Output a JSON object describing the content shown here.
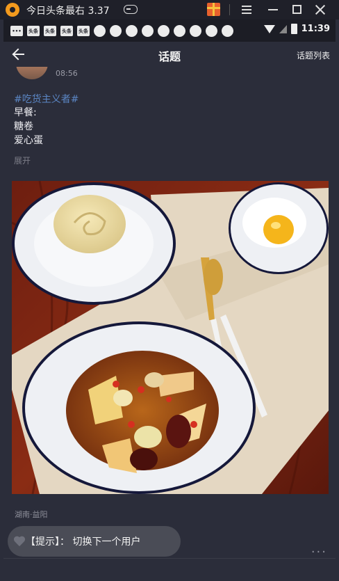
{
  "window": {
    "title": "今日头条最右 3.37",
    "icons": [
      "app-logo-icon",
      "gamepad-icon",
      "gift-icon",
      "menu-icon",
      "minimize-icon",
      "maximize-icon",
      "close-icon"
    ]
  },
  "status_bar": {
    "notification_badges": [
      "头条",
      "头条",
      "头条",
      "头条"
    ],
    "time": "11:39"
  },
  "header": {
    "title": "话题",
    "right_link": "话题列表",
    "back_icon": "back-arrow-icon"
  },
  "post": {
    "time": "08:56",
    "hashtag": "#吃货主义者#",
    "lines": [
      "早餐:",
      "糖卷",
      "爱心蛋"
    ],
    "expand_label": "展开",
    "location": "湖南·益阳"
  },
  "toast": {
    "text": "【提示】： 切换下一个用户"
  },
  "more": {
    "label": "..."
  }
}
